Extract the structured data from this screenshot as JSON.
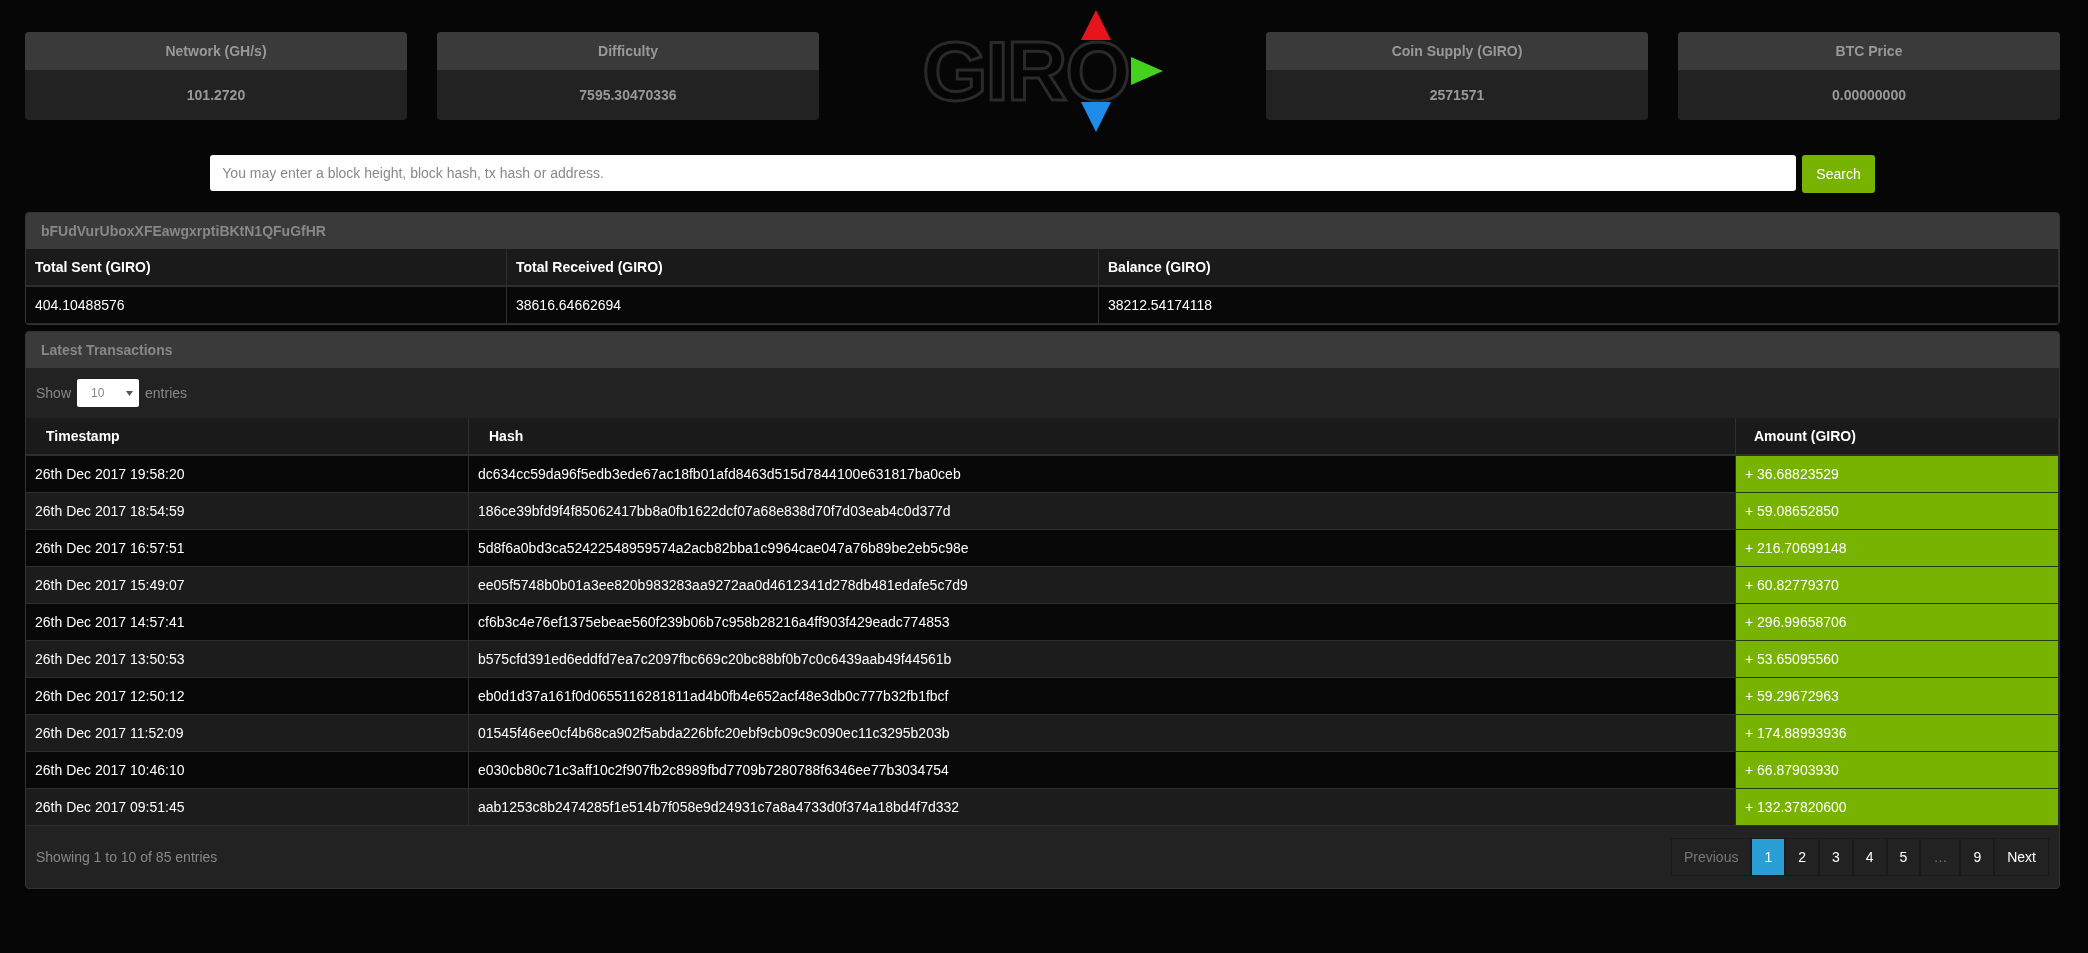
{
  "stats_left": [
    {
      "label": "Network (GH/s)",
      "value": "101.2720"
    },
    {
      "label": "Difficulty",
      "value": "7595.30470336"
    }
  ],
  "logo": {
    "text": "GIRO"
  },
  "stats_right": [
    {
      "label": "Coin Supply (GIRO)",
      "value": "2571571"
    },
    {
      "label": "BTC Price",
      "value": "0.00000000"
    }
  ],
  "search": {
    "placeholder": "You may enter a block height, block hash, tx hash or address.",
    "button": "Search"
  },
  "address": {
    "title": "bFUdVurUboxXFEawgxrptiBKtN1QFuGfHR",
    "columns": [
      "Total Sent (GIRO)",
      "Total Received (GIRO)",
      "Balance (GIRO)"
    ],
    "values": [
      "404.10488576",
      "38616.64662694",
      "38212.54174118"
    ]
  },
  "transactions": {
    "title": "Latest Transactions",
    "show_label": "Show",
    "page_size": "10",
    "entries_label": "entries",
    "columns": [
      "Timestamp",
      "Hash",
      "Amount (GIRO)"
    ],
    "rows": [
      {
        "timestamp": "26th Dec 2017 19:58:20",
        "hash": "dc634cc59da96f5edb3ede67ac18fb01afd8463d515d7844100e631817ba0ceb",
        "amount": "+ 36.68823529"
      },
      {
        "timestamp": "26th Dec 2017 18:54:59",
        "hash": "186ce39bfd9f4f85062417bb8a0fb1622dcf07a68e838d70f7d03eab4c0d377d",
        "amount": "+ 59.08652850"
      },
      {
        "timestamp": "26th Dec 2017 16:57:51",
        "hash": "5d8f6a0bd3ca52422548959574a2acb82bba1c9964cae047a76b89be2eb5c98e",
        "amount": "+ 216.70699148"
      },
      {
        "timestamp": "26th Dec 2017 15:49:07",
        "hash": "ee05f5748b0b01a3ee820b983283aa9272aa0d4612341d278db481edafe5c7d9",
        "amount": "+ 60.82779370"
      },
      {
        "timestamp": "26th Dec 2017 14:57:41",
        "hash": "cf6b3c4e76ef1375ebeae560f239b06b7c958b28216a4ff903f429eadc774853",
        "amount": "+ 296.99658706"
      },
      {
        "timestamp": "26th Dec 2017 13:50:53",
        "hash": "b575cfd391ed6eddfd7ea7c2097fbc669c20bc88bf0b7c0c6439aab49f44561b",
        "amount": "+ 53.65095560"
      },
      {
        "timestamp": "26th Dec 2017 12:50:12",
        "hash": "eb0d1d37a161f0d0655116281811ad4b0fb4e652acf48e3db0c777b32fb1fbcf",
        "amount": "+ 59.29672963"
      },
      {
        "timestamp": "26th Dec 2017 11:52:09",
        "hash": "01545f46ee0cf4b68ca902f5abda226bfc20ebf9cb09c9c090ec11c3295b203b",
        "amount": "+ 174.88993936"
      },
      {
        "timestamp": "26th Dec 2017 10:46:10",
        "hash": "e030cb80c71c3aff10c2f907fb2c8989fbd7709b7280788f6346ee77b3034754",
        "amount": "+ 66.87903930"
      },
      {
        "timestamp": "26th Dec 2017 09:51:45",
        "hash": "aab1253c8b2474285f1e514b7f058e9d24931c7a8a4733d0f374a18bd4f7d332",
        "amount": "+ 132.37820600"
      }
    ],
    "info": "Showing 1 to 10 of 85 entries",
    "pages": [
      {
        "label": "Previous",
        "selected": false,
        "disabled": true
      },
      {
        "label": "1",
        "selected": true,
        "disabled": false
      },
      {
        "label": "2",
        "selected": false,
        "disabled": false
      },
      {
        "label": "3",
        "selected": false,
        "disabled": false
      },
      {
        "label": "4",
        "selected": false,
        "disabled": false
      },
      {
        "label": "5",
        "selected": false,
        "disabled": false
      },
      {
        "label": "…",
        "selected": false,
        "disabled": true
      },
      {
        "label": "9",
        "selected": false,
        "disabled": false
      },
      {
        "label": "Next",
        "selected": false,
        "disabled": false
      }
    ]
  }
}
